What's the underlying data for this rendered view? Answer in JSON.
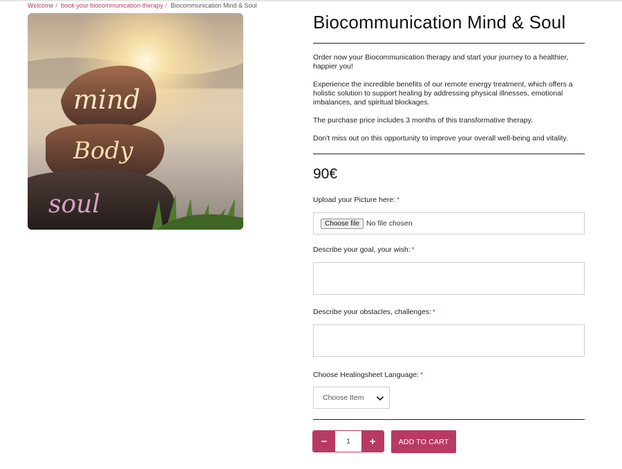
{
  "breadcrumb": {
    "items": [
      "Welcome",
      "book your biocommunication-therapy"
    ],
    "separator": "/",
    "current": "Biocommunication Mind & Soul"
  },
  "product": {
    "image_words": [
      "mind",
      "Body",
      "soul"
    ],
    "title": "Biocommunication Mind & Soul",
    "description": [
      "Order now your Biocommunication therapy and start your journey to a healthier, happier you!",
      "Experience the incredible benefits of our remote energy treatment, which offers a holistic solution to support healing by addressing physical illnesses, emotional imbalances, and spiritual blockages.",
      "The purchase price includes 3 months of this transformative therapy.",
      "Don't miss out on this opportunity to improve your overall well-being and vitality."
    ],
    "price": "90€"
  },
  "form": {
    "required_mark": "*",
    "upload": {
      "label": "Upload your Picture here:",
      "button_label": "Choose file",
      "status": "No file chosen"
    },
    "goal": {
      "label": "Describe your goal, your wish:",
      "value": ""
    },
    "obstacles": {
      "label": "Describe your obstacles, challenges:",
      "value": ""
    },
    "language": {
      "label": "Choose Healingsheet Language:",
      "selected": "Choose Item"
    }
  },
  "cart": {
    "minus": "−",
    "plus": "+",
    "quantity": "1",
    "add_label": "ADD TO CART"
  },
  "colors": {
    "accent": "#b83a63",
    "required": "#c8324f",
    "link": "#b83a63"
  }
}
